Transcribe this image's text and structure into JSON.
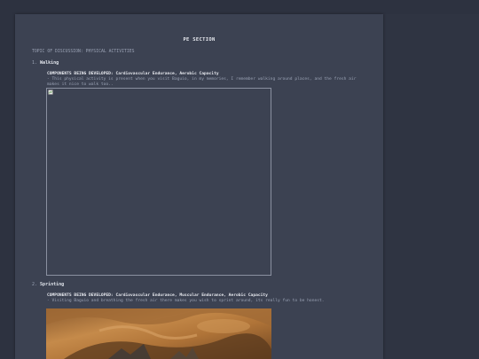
{
  "document": {
    "title": "PE SECTION",
    "topic": "TOPIC OF DISCUSSION: PHYSICAL ACTIVITIES",
    "items": [
      {
        "number": "1.",
        "name": "Walking",
        "components": "COMPONENTS BEING DEVELOPED: Cardiovascular Endurance, Aerobic Capacity",
        "description": "- This physical activity is present when you visit Baguio, in my memories, I remember walking around places, and the fresh air makes it nice to walk too..",
        "image": "broken-image-icon"
      },
      {
        "number": "2.",
        "name": "Sprinting",
        "components": "COMPONENTS BEING DEVELOPED: Cardiovascular Endurance, Muscular Endurance, Aerobic Capacity",
        "description": "- Visiting Baguio and breathing the fresh air there makes you wish to sprint around, its really fun to be honest.",
        "image": "photo"
      }
    ]
  },
  "colors": {
    "background": "#2d3240",
    "page": "#3c4252",
    "text_primary": "#e6e8ee",
    "text_secondary": "#9aa2b4"
  }
}
